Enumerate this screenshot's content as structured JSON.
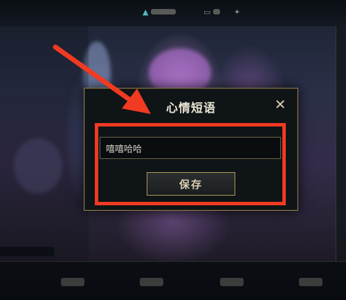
{
  "dialog": {
    "title": "心情短语",
    "close_glyph": "✕",
    "input_value": "嘻嘻哈哈",
    "save_label": "保存"
  },
  "annotation": {
    "color": "#f03a22"
  },
  "colors": {
    "dialog_border": "#8c7a4a",
    "dialog_bg": "#0f1417",
    "title_text": "#e8e2d2",
    "button_border": "#b09a5c"
  }
}
